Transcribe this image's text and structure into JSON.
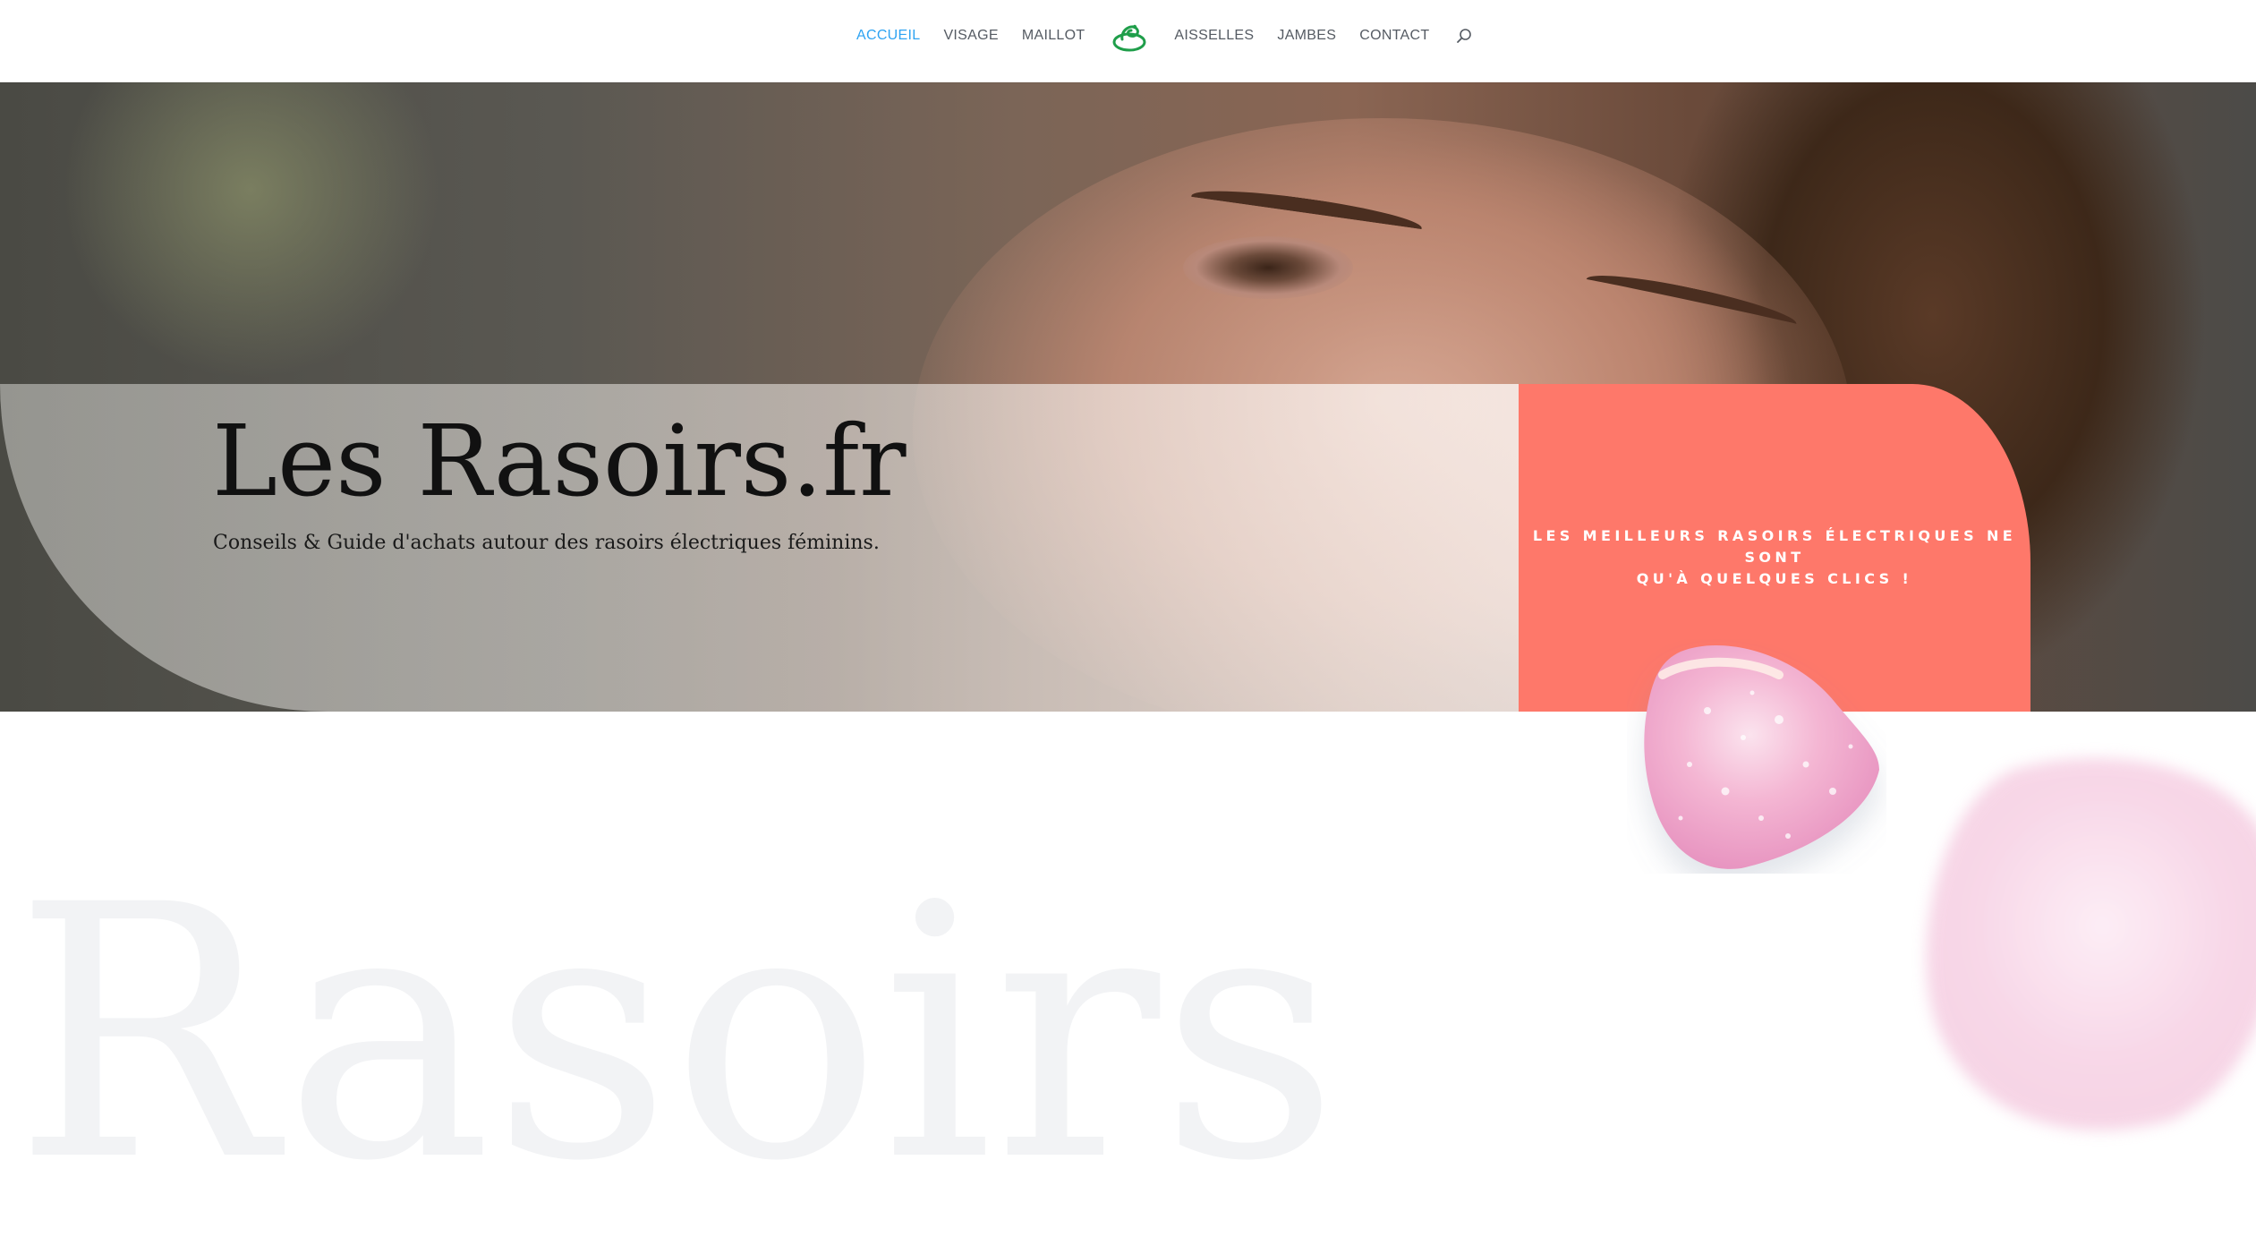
{
  "nav": {
    "items_left": [
      {
        "label": "ACCUEIL",
        "active": true
      },
      {
        "label": "VISAGE",
        "active": false
      },
      {
        "label": "MAILLOT",
        "active": false
      }
    ],
    "items_right": [
      {
        "label": "AISSELLES",
        "active": false
      },
      {
        "label": "JAMBES",
        "active": false
      },
      {
        "label": "CONTACT",
        "active": false
      }
    ],
    "logo_icon": "swirl-logo-icon",
    "search_icon": "search-icon",
    "active_color": "#2ea3f2",
    "text_color": "#555b63"
  },
  "hero": {
    "title": "Les Rasoirs.fr",
    "subtitle": "Conseils & Guide d'achats autour des rasoirs électriques féminins.",
    "promo": {
      "line1": "LES MEILLEURS RASOIRS ÉLECTRIQUES NE SONT",
      "line2": "QU'À QUELQUES CLICS !",
      "bg_color": "#fe786a"
    }
  },
  "background_word": "Rasoirs",
  "decor": {
    "petal_icon": "rose-petal-icon"
  }
}
